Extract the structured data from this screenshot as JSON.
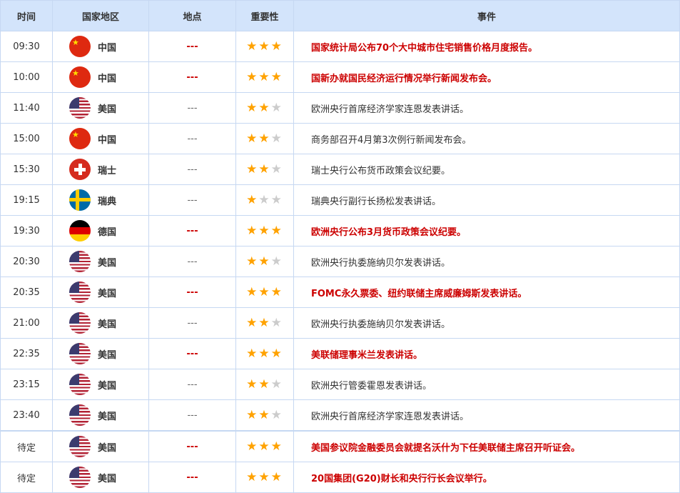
{
  "headers": [
    "时间",
    "国家地区",
    "地点",
    "重要性",
    "事件"
  ],
  "colors": {
    "important": "#cc0000",
    "star": "#ffa200",
    "header_bg": "#d3e4fb"
  },
  "rows": [
    {
      "time": "09:30",
      "flag": "cn",
      "country": "中国",
      "location": "---",
      "stars": 3,
      "event": "国家统计局公布70个大中城市住宅销售价格月度报告。",
      "hi": true
    },
    {
      "time": "10:00",
      "flag": "cn",
      "country": "中国",
      "location": "---",
      "stars": 3,
      "event": "国新办就国民经济运行情况举行新闻发布会。",
      "hi": true
    },
    {
      "time": "11:40",
      "flag": "us",
      "country": "美国",
      "location": "---",
      "stars": 2,
      "event": "欧洲央行首席经济学家连恩发表讲话。",
      "hi": false
    },
    {
      "time": "15:00",
      "flag": "cn",
      "country": "中国",
      "location": "---",
      "stars": 2,
      "event": "商务部召开4月第3次例行新闻发布会。",
      "hi": false
    },
    {
      "time": "15:30",
      "flag": "ch",
      "country": "瑞士",
      "location": "---",
      "stars": 2,
      "event": "瑞士央行公布货币政策会议纪要。",
      "hi": false
    },
    {
      "time": "19:15",
      "flag": "se",
      "country": "瑞典",
      "location": "---",
      "stars": 1,
      "event": "瑞典央行副行长扬松发表讲话。",
      "hi": false
    },
    {
      "time": "19:30",
      "flag": "de",
      "country": "德国",
      "location": "---",
      "stars": 3,
      "event": "欧洲央行公布3月货币政策会议纪要。",
      "hi": true
    },
    {
      "time": "20:30",
      "flag": "us",
      "country": "美国",
      "location": "---",
      "stars": 2,
      "event": "欧洲央行执委施纳贝尔发表讲话。",
      "hi": false
    },
    {
      "time": "20:35",
      "flag": "us",
      "country": "美国",
      "location": "---",
      "stars": 3,
      "event": "FOMC永久票委、纽约联储主席威廉姆斯发表讲话。",
      "hi": true
    },
    {
      "time": "21:00",
      "flag": "us",
      "country": "美国",
      "location": "---",
      "stars": 2,
      "event": "欧洲央行执委施纳贝尔发表讲话。",
      "hi": false
    },
    {
      "time": "22:35",
      "flag": "us",
      "country": "美国",
      "location": "---",
      "stars": 3,
      "event": "美联储理事米兰发表讲话。",
      "hi": true
    },
    {
      "time": "23:15",
      "flag": "us",
      "country": "美国",
      "location": "---",
      "stars": 2,
      "event": "欧洲央行管委霍恩发表讲话。",
      "hi": false
    },
    {
      "time": "23:40",
      "flag": "us",
      "country": "美国",
      "location": "---",
      "stars": 2,
      "event": "欧洲央行首席经济学家连恩发表讲话。",
      "hi": false
    },
    {
      "time": "待定",
      "flag": "us",
      "country": "美国",
      "location": "---",
      "stars": 3,
      "event": "美国参议院金融委员会就提名沃什为下任美联储主席召开听证会。",
      "hi": true,
      "sep": true
    },
    {
      "time": "待定",
      "flag": "us",
      "country": "美国",
      "location": "---",
      "stars": 3,
      "event": "20国集团(G20)财长和央行行长会议举行。",
      "hi": true
    }
  ]
}
